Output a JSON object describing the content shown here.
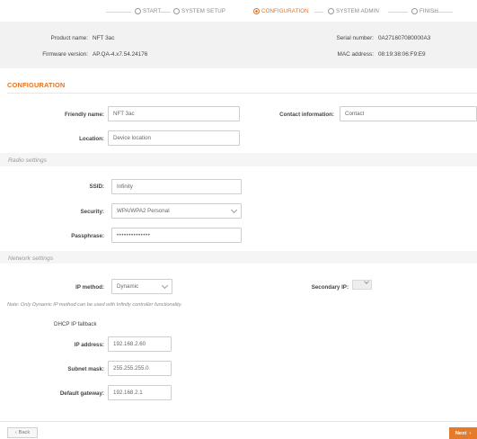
{
  "wizard": {
    "steps": [
      {
        "label": "START",
        "active": false
      },
      {
        "label": "SYSTEM SETUP",
        "active": false
      },
      {
        "label": "CONFIGURATION",
        "active": true
      },
      {
        "label": "SYSTEM ADMIN",
        "active": false
      },
      {
        "label": "FINISH",
        "active": false
      }
    ]
  },
  "info": {
    "product_name_label": "Product name:",
    "product_name": "NFT 3ac",
    "serial_number_label": "Serial number:",
    "serial_number": "0A271607080000A3",
    "firmware_label": "Firmware version:",
    "firmware": "AP.QA-4.x7.54.24176",
    "mac_label": "MAC address:",
    "mac": "08:19:38:06:F9:E9"
  },
  "section": {
    "title": "CONFIGURATION"
  },
  "general": {
    "friendly_name_label": "Friendly name:",
    "friendly_name_value": "NFT 3ac",
    "contact_label": "Contact information:",
    "contact_value": "Contact",
    "location_label": "Location:",
    "location_value": "Device location"
  },
  "radio": {
    "heading": "Radio settings",
    "ssid_label": "SSID:",
    "ssid_value": "Infinity",
    "security_label": "Security:",
    "security_value": "WPA/WPA2 Personal",
    "passphrase_label": "Passphrase:",
    "passphrase_value": "••••••••••••••"
  },
  "network": {
    "heading": "Network settings",
    "ip_method_label": "IP method:",
    "ip_method_value": "Dynamic",
    "secondary_ip_label": "Secondary IP:",
    "note": "Note: Only Dynamic IP method can be used with Infinity controller functionality.",
    "fallback_title": "DHCP IP fallback",
    "ip_address_label": "IP address:",
    "ip_address_value": "192.168.2.60",
    "subnet_label": "Subnet mask:",
    "subnet_value": "255.255.255.0",
    "gateway_label": "Default gateway:",
    "gateway_value": "192.168.2.1"
  },
  "footer": {
    "back_label": "Back",
    "next_label": "Next"
  },
  "colors": {
    "accent": "#e4731f",
    "band": "#f5f5f5"
  }
}
